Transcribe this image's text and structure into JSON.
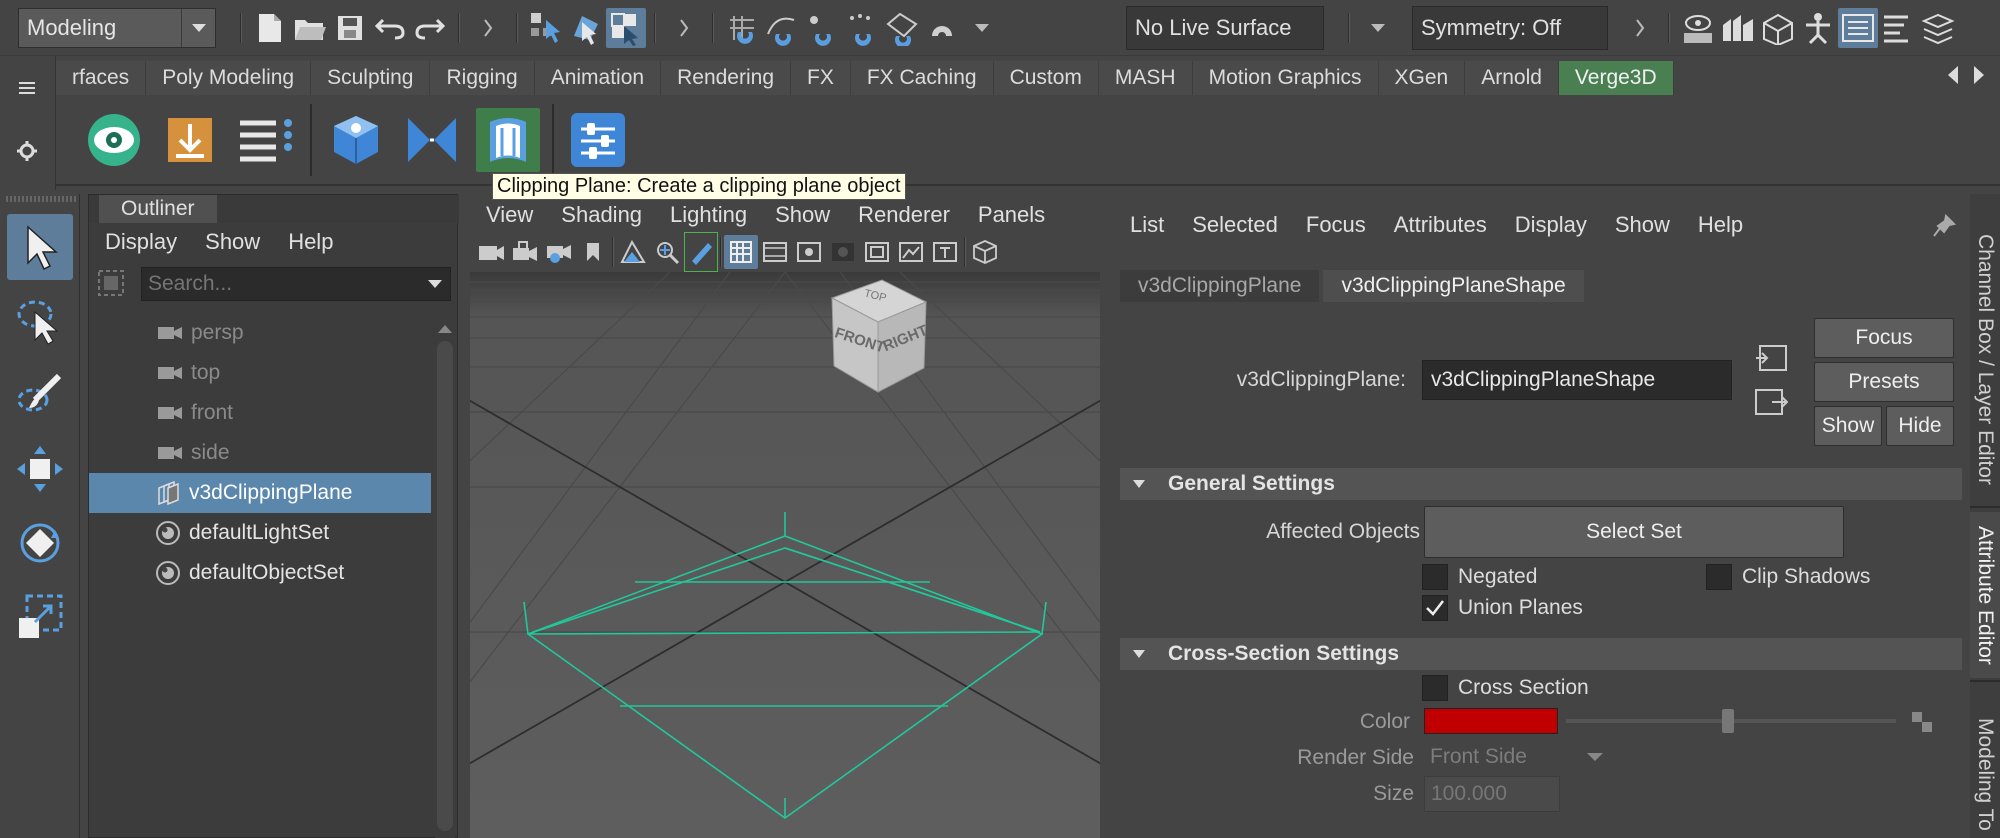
{
  "statusline": {
    "mode": "Modeling",
    "live_surface": "No Live Surface",
    "symmetry": "Symmetry: Off"
  },
  "shelf_tabs": [
    {
      "label": "rfaces",
      "active": false
    },
    {
      "label": "Poly Modeling",
      "active": false
    },
    {
      "label": "Sculpting",
      "active": false
    },
    {
      "label": "Rigging",
      "active": false
    },
    {
      "label": "Animation",
      "active": false
    },
    {
      "label": "Rendering",
      "active": false
    },
    {
      "label": "FX",
      "active": false
    },
    {
      "label": "FX Caching",
      "active": false
    },
    {
      "label": "Custom",
      "active": false
    },
    {
      "label": "MASH",
      "active": false
    },
    {
      "label": "Motion Graphics",
      "active": false
    },
    {
      "label": "XGen",
      "active": false
    },
    {
      "label": "Arnold",
      "active": false
    },
    {
      "label": "Verge3D",
      "active": true
    }
  ],
  "tooltip": "Clipping Plane: Create a clipping plane object",
  "outliner": {
    "tab": "Outliner",
    "menu": [
      "Display",
      "Show",
      "Help"
    ],
    "search_placeholder": "Search...",
    "items": [
      {
        "label": "persp",
        "icon": "camera-icon",
        "dim": true
      },
      {
        "label": "top",
        "icon": "camera-icon",
        "dim": true
      },
      {
        "label": "front",
        "icon": "camera-icon",
        "dim": true
      },
      {
        "label": "side",
        "icon": "camera-icon",
        "dim": true
      },
      {
        "label": "v3dClippingPlane",
        "icon": "clipping-plane-icon",
        "selected": true
      },
      {
        "label": "defaultLightSet",
        "icon": "set-icon"
      },
      {
        "label": "defaultObjectSet",
        "icon": "set-icon"
      }
    ]
  },
  "viewport": {
    "menu": [
      "View",
      "Shading",
      "Lighting",
      "Show",
      "Renderer",
      "Panels"
    ],
    "viewcube": {
      "top": "TOP",
      "front": "FRONT",
      "right": "RIGHT"
    }
  },
  "attribute_editor": {
    "menu": [
      "List",
      "Selected",
      "Focus",
      "Attributes",
      "Display",
      "Show",
      "Help"
    ],
    "tabs": [
      {
        "label": "v3dClippingPlane",
        "active": false
      },
      {
        "label": "v3dClippingPlaneShape",
        "active": true
      }
    ],
    "node_label": "v3dClippingPlane:",
    "node_value": "v3dClippingPlaneShape",
    "buttons": {
      "focus": "Focus",
      "presets": "Presets",
      "show": "Show",
      "hide": "Hide"
    },
    "general": {
      "title": "General Settings",
      "affected_label": "Affected Objects",
      "select_set": "Select Set",
      "negated": {
        "label": "Negated",
        "checked": false
      },
      "clip_shadows": {
        "label": "Clip Shadows",
        "checked": false
      },
      "union_planes": {
        "label": "Union Planes",
        "checked": true
      }
    },
    "cross_section": {
      "title": "Cross-Section Settings",
      "cross_section": {
        "label": "Cross Section",
        "checked": false
      },
      "color_label": "Color",
      "color_value": "#c00000",
      "render_side_label": "Render Side",
      "render_side_value": "Front Side",
      "size_label": "Size",
      "size_value": "100.000"
    }
  },
  "side_tabs": [
    "Channel Box / Layer Editor",
    "Attribute Editor",
    "Modeling To"
  ]
}
